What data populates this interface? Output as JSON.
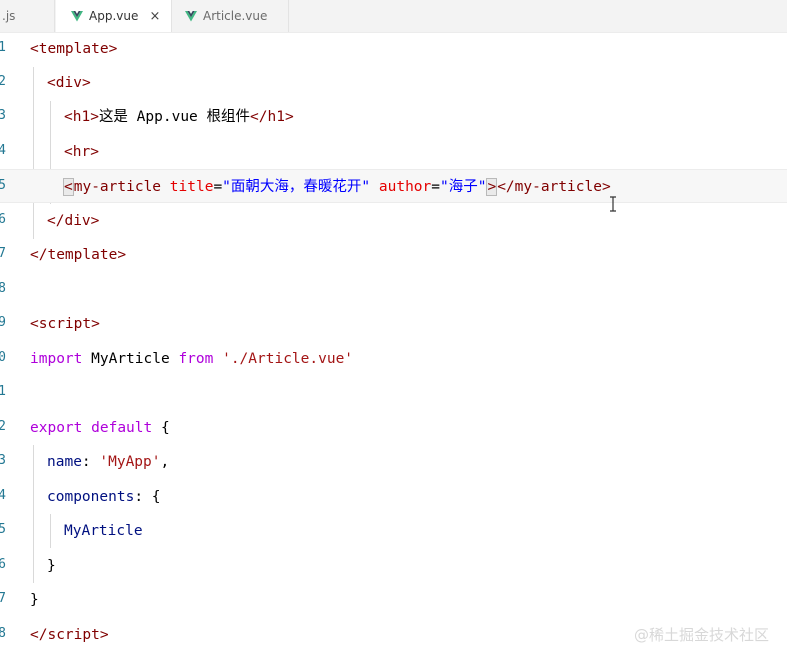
{
  "tabs": [
    {
      "label": ".js"
    },
    {
      "label": "App.vue",
      "close": "×"
    },
    {
      "label": "Article.vue"
    }
  ],
  "line_numbers": [
    "1",
    "2",
    "3",
    "4",
    "5",
    "6",
    "7",
    "8",
    "9",
    "0",
    "1",
    "2",
    "3",
    "4",
    "5",
    "6",
    "7",
    "8"
  ],
  "code": {
    "l1": {
      "open": "<",
      "tag": "template",
      "close": ">"
    },
    "l2": {
      "open": "<",
      "tag": "div",
      "close": ">"
    },
    "l3": {
      "open": "<",
      "tag": "h1",
      "close": ">",
      "text": "这是 App.vue 根组件",
      "end_open": "</",
      "end_tag": "h1",
      "end_close": ">"
    },
    "l4": {
      "open": "<",
      "tag": "hr",
      "close": ">"
    },
    "l5": {
      "open": "<",
      "tag": "my-article",
      "attr1": "title",
      "eq1": "=",
      "val1": "\"面朝大海，春暖花开\"",
      "attr2": "author",
      "eq2": "=",
      "val2": "\"海子\"",
      "close": ">",
      "end_open": "</",
      "end_tag": "my-article",
      "end_close": ">"
    },
    "l6": {
      "open": "</",
      "tag": "div",
      "close": ">"
    },
    "l7": {
      "open": "</",
      "tag": "template",
      "close": ">"
    },
    "l9": {
      "open": "<",
      "tag": "script",
      "close": ">"
    },
    "l10": {
      "kw1": "import",
      "name": "MyArticle",
      "kw2": "from",
      "path": "'./Article.vue'"
    },
    "l12": {
      "kw1": "export",
      "kw2": "default",
      "brace": "{"
    },
    "l13": {
      "key": "name",
      "colon": ":",
      "value": "'MyApp'",
      "comma": ","
    },
    "l14": {
      "key": "components",
      "colon": ":",
      "brace": "{"
    },
    "l15": {
      "name": "MyArticle"
    },
    "l16": {
      "brace": "}"
    },
    "l17": {
      "brace": "}"
    },
    "l18": {
      "open": "</",
      "tag": "script",
      "close": ">"
    }
  },
  "watermark": "@稀土掘金技术社区",
  "colors": {
    "tag": "#800000",
    "attr": "#e50000",
    "string_blue": "#0000ff",
    "keyword": "#af00db",
    "property": "#001080",
    "string_red": "#a31515",
    "line_number": "#237893"
  }
}
